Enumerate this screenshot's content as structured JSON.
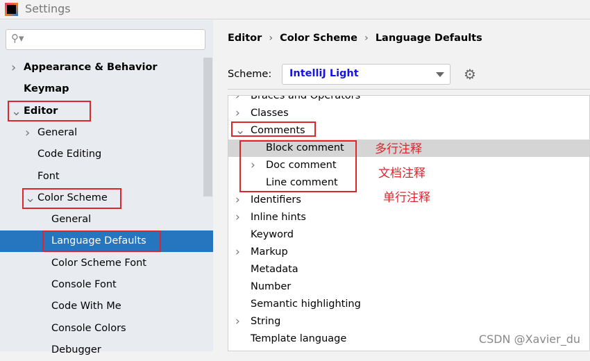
{
  "window": {
    "title": "Settings",
    "logo": "IJ"
  },
  "sidebar": {
    "search_placeholder": "",
    "items": [
      {
        "label": "Appearance & Behavior",
        "bold": true,
        "chevron": "right",
        "indent": 0
      },
      {
        "label": "Keymap",
        "bold": true,
        "chevron": "",
        "indent": 0
      },
      {
        "label": "Editor",
        "bold": true,
        "chevron": "down",
        "indent": 0
      },
      {
        "label": "General",
        "chevron": "right",
        "indent": 1
      },
      {
        "label": "Code Editing",
        "chevron": "",
        "indent": 1
      },
      {
        "label": "Font",
        "chevron": "",
        "indent": 1
      },
      {
        "label": "Color Scheme",
        "chevron": "down",
        "indent": 1
      },
      {
        "label": "General",
        "chevron": "",
        "indent": 2
      },
      {
        "label": "Language Defaults",
        "chevron": "",
        "indent": 2,
        "selected": true
      },
      {
        "label": "Color Scheme Font",
        "chevron": "",
        "indent": 2
      },
      {
        "label": "Console Font",
        "chevron": "",
        "indent": 2
      },
      {
        "label": "Code With Me",
        "chevron": "",
        "indent": 2
      },
      {
        "label": "Console Colors",
        "chevron": "",
        "indent": 2
      },
      {
        "label": "Debugger",
        "chevron": "",
        "indent": 2
      }
    ]
  },
  "breadcrumb": [
    "Editor",
    "Color Scheme",
    "Language Defaults"
  ],
  "scheme": {
    "label": "Scheme:",
    "value": "IntelliJ Light"
  },
  "tree": [
    {
      "label": "Braces and Operators",
      "chevron": "right",
      "indent": 0
    },
    {
      "label": "Classes",
      "chevron": "right",
      "indent": 0
    },
    {
      "label": "Comments",
      "chevron": "down",
      "indent": 0
    },
    {
      "label": "Block comment",
      "chevron": "",
      "indent": 1,
      "selected": true
    },
    {
      "label": "Doc comment",
      "chevron": "right",
      "indent": 1
    },
    {
      "label": "Line comment",
      "chevron": "",
      "indent": 1
    },
    {
      "label": "Identifiers",
      "chevron": "right",
      "indent": 0
    },
    {
      "label": "Inline hints",
      "chevron": "right",
      "indent": 0
    },
    {
      "label": "Keyword",
      "chevron": "",
      "indent": 0
    },
    {
      "label": "Markup",
      "chevron": "right",
      "indent": 0
    },
    {
      "label": "Metadata",
      "chevron": "",
      "indent": 0
    },
    {
      "label": "Number",
      "chevron": "",
      "indent": 0
    },
    {
      "label": "Semantic highlighting",
      "chevron": "",
      "indent": 0
    },
    {
      "label": "String",
      "chevron": "right",
      "indent": 0
    },
    {
      "label": "Template language",
      "chevron": "",
      "indent": 0
    }
  ],
  "annotations": {
    "block": "多行注释",
    "doc": "文档注释",
    "line": "单行注释",
    "color": "#e0242c"
  },
  "watermark": "CSDN @Xavier_du"
}
